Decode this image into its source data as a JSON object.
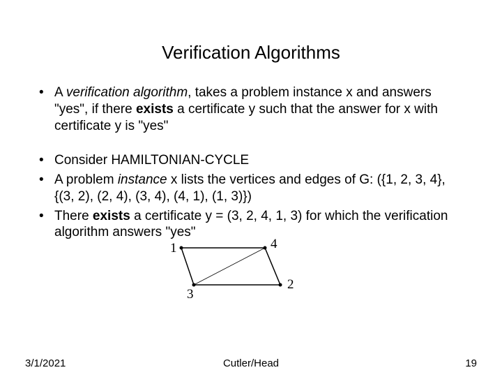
{
  "title": "Verification Algorithms",
  "bullets": {
    "b1_pre": "A ",
    "b1_italic": "verification algorithm",
    "b1_mid": ", takes a problem instance x and answers \"yes\", if there ",
    "b1_bold": "exists",
    "b1_post": " a certificate y such that the answer for x with certificate y is \"yes\"",
    "b2": "Consider HAMILTONIAN-CYCLE",
    "b3_pre": "A problem ",
    "b3_italic": "instance",
    "b3_post": " x lists the vertices and edges of G: ({1, 2, 3, 4}, {(3, 2), (2, 4), (3, 4), (4, 1), (1, 3)})",
    "b4_pre": "There ",
    "b4_bold": "exists",
    "b4_post": " a certificate y = (3, 2, 4, 1, 3) for which the verification algorithm answers \"yes\""
  },
  "graph": {
    "v1": "1",
    "v2": "2",
    "v3": "3",
    "v4": "4"
  },
  "footer": {
    "date": "3/1/2021",
    "center": "Cutler/Head",
    "page": "19"
  }
}
